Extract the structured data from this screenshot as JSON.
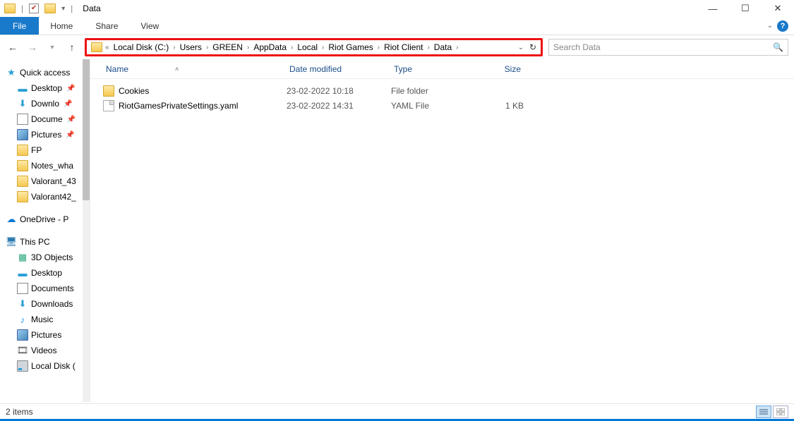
{
  "window": {
    "title": "Data"
  },
  "ribbon": {
    "file": "File",
    "items": [
      "Home",
      "Share",
      "View"
    ]
  },
  "breadcrumbs": [
    "Local Disk (C:)",
    "Users",
    "GREEN",
    "AppData",
    "Local",
    "Riot Games",
    "Riot Client",
    "Data"
  ],
  "search": {
    "placeholder": "Search Data"
  },
  "columns": {
    "name": "Name",
    "date": "Date modified",
    "type": "Type",
    "size": "Size"
  },
  "rows": [
    {
      "icon": "folder",
      "name": "Cookies",
      "date": "23-02-2022 10:18",
      "type": "File folder",
      "size": ""
    },
    {
      "icon": "file",
      "name": "RiotGamesPrivateSettings.yaml",
      "date": "23-02-2022 14:31",
      "type": "YAML File",
      "size": "1 KB"
    }
  ],
  "sidebar": {
    "quick": "Quick access",
    "quick_items": [
      {
        "icon": "desktop",
        "label": "Desktop",
        "pinned": true
      },
      {
        "icon": "download",
        "label": "Downlo",
        "pinned": true
      },
      {
        "icon": "doc",
        "label": "Docume",
        "pinned": true
      },
      {
        "icon": "pic",
        "label": "Pictures",
        "pinned": true
      },
      {
        "icon": "folder",
        "label": "FP"
      },
      {
        "icon": "folder",
        "label": "Notes_wha"
      },
      {
        "icon": "folder",
        "label": "Valorant_43"
      },
      {
        "icon": "folder",
        "label": "Valorant42_"
      }
    ],
    "onedrive": "OneDrive - P",
    "thispc": "This PC",
    "thispc_items": [
      {
        "icon": "3d",
        "label": "3D Objects"
      },
      {
        "icon": "desktop",
        "label": "Desktop"
      },
      {
        "icon": "doc",
        "label": "Documents"
      },
      {
        "icon": "download",
        "label": "Downloads"
      },
      {
        "icon": "music",
        "label": "Music"
      },
      {
        "icon": "pic",
        "label": "Pictures"
      },
      {
        "icon": "video",
        "label": "Videos"
      },
      {
        "icon": "disk",
        "label": "Local Disk ("
      }
    ]
  },
  "status": {
    "text": "2 items"
  }
}
